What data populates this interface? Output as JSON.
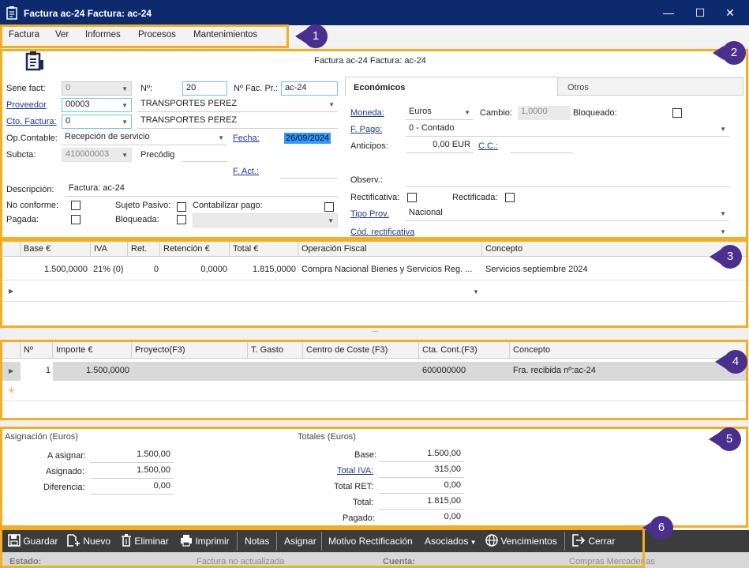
{
  "window": {
    "title": "Factura ac-24  Factura: ac-24",
    "minimize": "—",
    "maximize": "☐",
    "close": "✕"
  },
  "menu": [
    "Factura",
    "Ver",
    "Informes",
    "Procesos",
    "Mantenimientos"
  ],
  "badges": [
    "1",
    "2",
    "3",
    "4",
    "5",
    "6"
  ],
  "header": {
    "caption": "Factura ac-24  Factura: ac-24",
    "serie_label": "Serie fact:",
    "serie_value": "0",
    "num_label": "Nº:",
    "num_value": "20",
    "nfacpr_label": "Nº Fac. Pr.:",
    "nfacpr_value": "ac-24",
    "proveedor_label": "Proveedor",
    "proveedor_code": "00003",
    "proveedor_name": "TRANSPORTES PEREZ",
    "ctofactura_label": "Cto. Factura:",
    "ctofactura_value": "0",
    "ctofactura_name": "TRANSPORTES PEREZ",
    "opcontable_label": "Op.Contable:",
    "opcontable_value": "Recepción de servicio",
    "fecha_label": "Fecha:",
    "fecha_value": "26/09/2024",
    "subcta_label": "Subcta:",
    "subcta_value": "410000003",
    "precodig_label": "Precódig",
    "fact_label": "F. Act.:",
    "descripcion_label": "Descripción:",
    "descripcion_value": "Factura: ac-24",
    "noconforme_label": "No conforme:",
    "sujetopasivo_label": "Sujeto Pasivo:",
    "contabilizar_label": "Contabilizar pago:",
    "pagada_label": "Pagada:",
    "bloqueada_label": "Bloqueada:"
  },
  "tabs": [
    "Económicos",
    "Otros"
  ],
  "economicos": {
    "moneda_label": "Moneda:",
    "moneda_value": "Euros",
    "cambio_label": "Cambio:",
    "cambio_value": "1,0000",
    "bloqueado_label": "Bloqueado:",
    "fpago_label": "F. Pago:",
    "fpago_value": "0 - Contado",
    "anticipos_label": "Anticipos:",
    "anticipos_value": "0,00 EUR",
    "cc_label": "C.C.:",
    "observ_label": "Observ.:",
    "rectificativa_label": "Rectificativa:",
    "rectificada_label": "Rectificada:",
    "tipoprov_label": "Tipo Prov.",
    "tipoprov_value": "Nacional",
    "codrect_label": "Cód. rectificativa"
  },
  "tax_grid": {
    "columns": [
      "Base €",
      "IVA",
      "Ret.",
      "Retención €",
      "Total €",
      "Operación Fiscal",
      "Concepto"
    ],
    "rows": [
      [
        "1.500,0000",
        "21% (0)",
        "0",
        "0,0000",
        "1.815,0000",
        "Compra Nacional Bienes y Servicios Reg. ...",
        "Servicios septiembre 2024"
      ]
    ]
  },
  "splitter": "...",
  "lines_grid": {
    "columns": [
      "Nº",
      "Importe €",
      "Proyecto(F3)",
      "T. Gasto",
      "Centro de Coste (F3)",
      "Cta. Cont.(F3)",
      "Concepto"
    ],
    "rows": [
      [
        "1",
        "1.500,0000",
        "",
        "",
        "",
        "600000000",
        "Fra. recibida nº:ac-24"
      ]
    ],
    "new_row_marker": "✳"
  },
  "asignacion": {
    "title": "Asignación (Euros)",
    "a_asignar_label": "A asignar:",
    "a_asignar_value": "1.500,00",
    "asignado_label": "Asignado:",
    "asignado_value": "1.500,00",
    "diferencia_label": "Diferencia:",
    "diferencia_value": "0,00"
  },
  "totales": {
    "title": "Totales (Euros)",
    "base_label": "Base:",
    "base_value": "1.500,00",
    "iva_label": "Total IVA:",
    "iva_value": "315,00",
    "ret_label": "Total RET:",
    "ret_value": "0,00",
    "total_label": "Total:",
    "total_value": "1.815,00",
    "pagado_label": "Pagado:",
    "pagado_value": "0,00"
  },
  "toolbar": {
    "guardar": "Guardar",
    "nuevo": "Nuevo",
    "eliminar": "Eliminar",
    "imprimir": "Imprimir",
    "notas": "Notas",
    "asignar": "Asignar",
    "motivo": "Motivo Rectificación",
    "asociados": "Asociados",
    "vencimientos": "Vencimientos",
    "cerrar": "Cerrar"
  },
  "statusbar": {
    "estado_label": "Estado:",
    "estado_value": "Factura no actualizada",
    "cuenta_label": "Cuenta:",
    "cuenta_value": "Compras Mercaderías"
  },
  "colors": {
    "titlebar": "#0e2a6e",
    "highlight": "#f4ae1f",
    "badge": "#4b2f8f",
    "toolbar": "#3c3c3c"
  }
}
